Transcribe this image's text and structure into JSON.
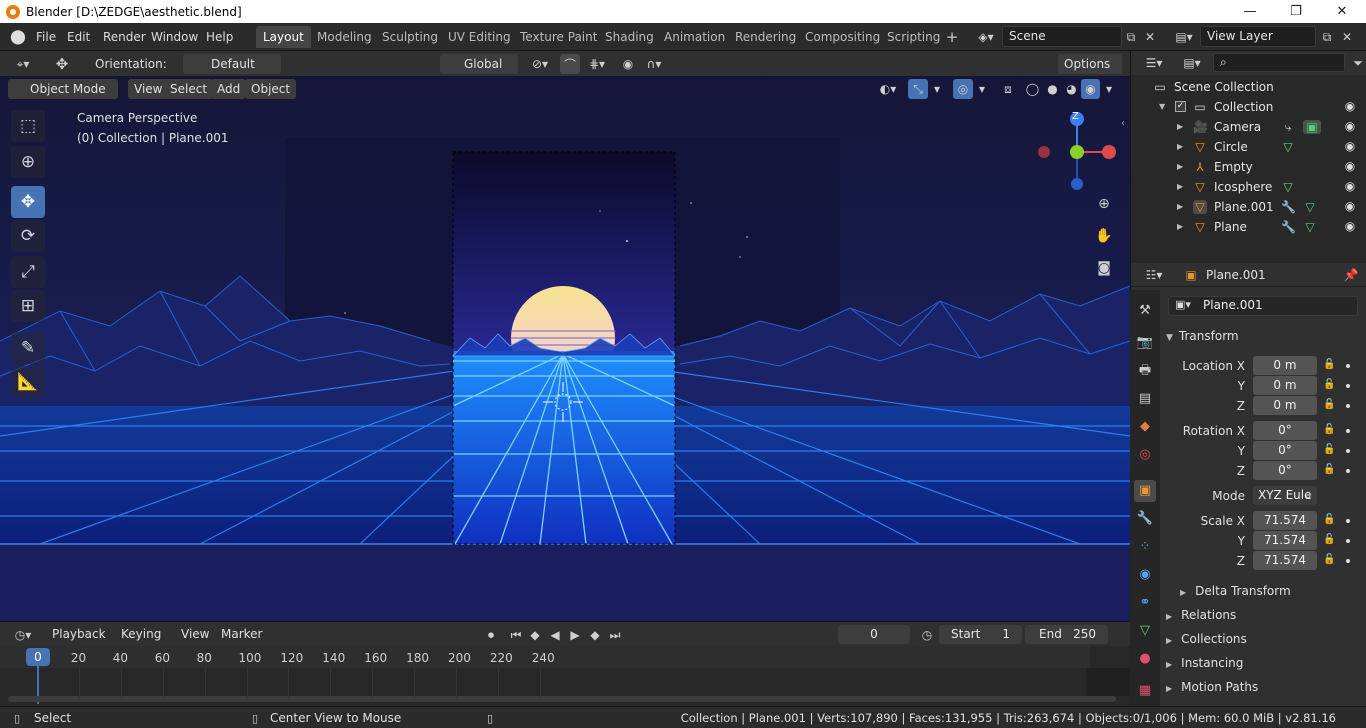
{
  "titlebar": {
    "title": "Blender [D:\\ZEDGE\\aesthetic.blend]",
    "minimize": "—",
    "restore": "❐",
    "close": "✕"
  },
  "menu": [
    "File",
    "Edit",
    "Render",
    "Window",
    "Help"
  ],
  "workspaces": [
    "Layout",
    "Modeling",
    "Sculpting",
    "UV Editing",
    "Texture Paint",
    "Shading",
    "Animation",
    "Rendering",
    "Compositing",
    "Scripting"
  ],
  "workspace_add": "+",
  "scene": {
    "name": "Scene"
  },
  "view_layer": {
    "name": "View Layer"
  },
  "viewport_header": {
    "orientation_label": "Orientation:",
    "orientation_value": "Default",
    "transform_space": "Global",
    "options": "Options",
    "mode": "Object Mode",
    "menus": [
      "View",
      "Select",
      "Add",
      "Object"
    ]
  },
  "viewport": {
    "overlay_line1": "Camera Perspective",
    "overlay_line2": "(0) Collection | Plane.001",
    "gizmo_z": "Z"
  },
  "outliner": {
    "search_placeholder": "",
    "scene_collection": "Scene Collection",
    "collection": "Collection",
    "objects": [
      {
        "name": "Camera",
        "icon": "camera-icon"
      },
      {
        "name": "Circle",
        "icon": "mesh-icon"
      },
      {
        "name": "Empty",
        "icon": "empty-icon"
      },
      {
        "name": "Icosphere",
        "icon": "mesh-icon"
      },
      {
        "name": "Plane.001",
        "icon": "mesh-icon"
      },
      {
        "name": "Plane",
        "icon": "mesh-icon"
      }
    ]
  },
  "properties": {
    "object_name": "Plane.001",
    "datablock_name": "Plane.001",
    "transform_title": "Transform",
    "location_label": "Location X",
    "location": [
      "0 m",
      "0 m",
      "0 m"
    ],
    "rotation_label": "Rotation X",
    "rotation": [
      "0°",
      "0°",
      "0°"
    ],
    "mode_label": "Mode",
    "mode_value": "XYZ Eule",
    "scale_label": "Scale X",
    "scale": [
      "71.574",
      "71.574",
      "71.574"
    ],
    "axis_y": "Y",
    "axis_z": "Z",
    "sections": [
      "Delta Transform",
      "Relations",
      "Collections",
      "Instancing",
      "Motion Paths"
    ]
  },
  "timeline": {
    "menus": [
      "Playback",
      "Keying",
      "View",
      "Marker"
    ],
    "current_frame": "0",
    "start_label": "Start",
    "start": "1",
    "end_label": "End",
    "end": "250",
    "ruler": [
      "0",
      "20",
      "40",
      "60",
      "80",
      "100",
      "120",
      "140",
      "160",
      "180",
      "200",
      "220",
      "240"
    ]
  },
  "statusbar": {
    "select": "Select",
    "center": "Center View to Mouse",
    "info": "Collection | Plane.001 | Verts:107,890 | Faces:131,955 | Tris:263,674 | Objects:0/1,006 | Mem: 60.0 MiB | v2.81.16"
  },
  "colors": {
    "accent": "#4772b3",
    "blender_orange": "#e87d0d",
    "mesh_icon": "#e59a2f",
    "data_icon": "#63c77e",
    "sky_top": "#0c0b2c",
    "sky_bottom": "#1a2a8a",
    "grid_line": "#37a8ff",
    "sun": "#f7e38f"
  }
}
